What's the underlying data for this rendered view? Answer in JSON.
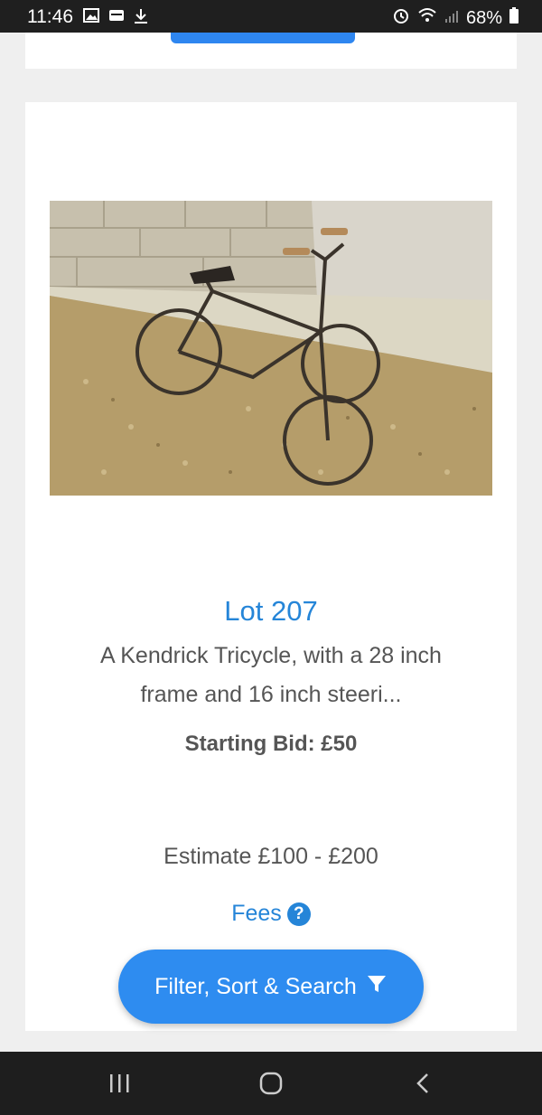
{
  "status_bar": {
    "time": "11:46",
    "battery": "68%",
    "left_icons": [
      "image-icon",
      "wallet-icon",
      "download-icon"
    ],
    "right_icons": [
      "alarm-icon",
      "wifi-icon",
      "signal-icon",
      "battery-icon"
    ]
  },
  "lot": {
    "title": "Lot 207",
    "description": "A Kendrick Tricycle, with a 28 inch frame and 16 inch steeri...",
    "starting_bid": "Starting Bid: £50",
    "estimate": "Estimate £100 - £200",
    "fees_label": "Fees"
  },
  "filter_button": {
    "label": "Filter, Sort & Search"
  },
  "colors": {
    "accent": "#2585d8",
    "button": "#2e8cf0",
    "page_bg": "#efefef",
    "text": "#555555"
  }
}
